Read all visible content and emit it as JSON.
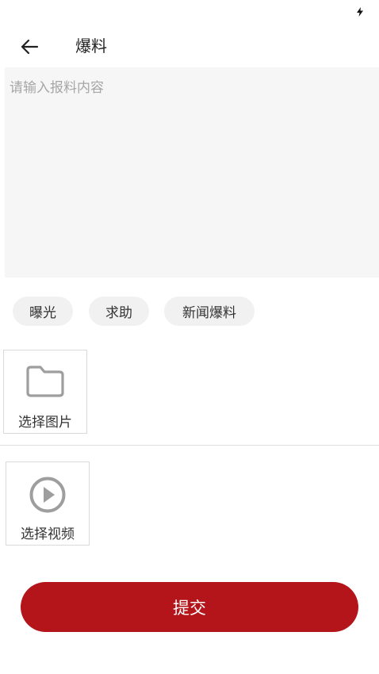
{
  "status_bar": {
    "icons": [
      "charging-bolt-icon"
    ]
  },
  "header": {
    "back_icon": "arrow-left-icon",
    "title": "爆料"
  },
  "content": {
    "placeholder": "请输入报料内容",
    "value": ""
  },
  "tags": [
    {
      "label": "曝光"
    },
    {
      "label": "求助"
    },
    {
      "label": "新闻爆料"
    }
  ],
  "image_picker": {
    "icon": "folder-icon",
    "label": "选择图片"
  },
  "video_picker": {
    "icon": "play-circle-icon",
    "label": "选择视频"
  },
  "submit": {
    "label": "提交"
  },
  "colors": {
    "accent": "#b3151a",
    "input_background": "#f6f6f6",
    "tag_background": "#f1f1f1",
    "placeholder_text": "#a6a6a6",
    "icon_gray": "#9e9e9e"
  }
}
